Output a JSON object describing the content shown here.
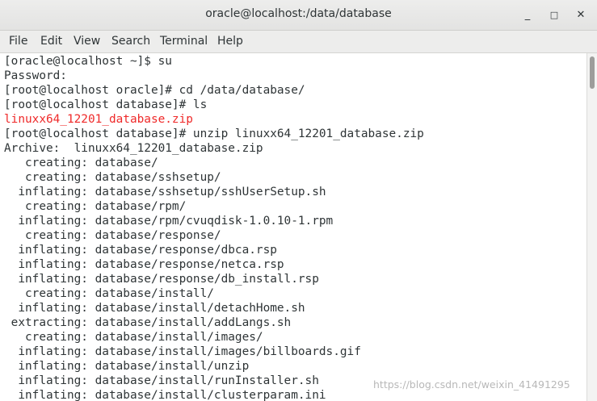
{
  "window": {
    "title": "oracle@localhost:/data/database",
    "minimize_label": "_",
    "maximize_label": "□",
    "close_label": "✕"
  },
  "menu": [
    "File",
    "Edit",
    "View",
    "Search",
    "Terminal",
    "Help"
  ],
  "terminal": {
    "lines": [
      {
        "text": "[oracle@localhost ~]$ su",
        "color": "default"
      },
      {
        "text": "Password:",
        "color": "default"
      },
      {
        "text": "[root@localhost oracle]# cd /data/database/",
        "color": "default"
      },
      {
        "text": "[root@localhost database]# ls",
        "color": "default"
      },
      {
        "text": "linuxx64_12201_database.zip",
        "color": "red"
      },
      {
        "text": "[root@localhost database]# unzip linuxx64_12201_database.zip",
        "color": "default"
      },
      {
        "text": "Archive:  linuxx64_12201_database.zip",
        "color": "default"
      },
      {
        "text": "   creating: database/",
        "color": "default"
      },
      {
        "text": "   creating: database/sshsetup/",
        "color": "default"
      },
      {
        "text": "  inflating: database/sshsetup/sshUserSetup.sh",
        "color": "default"
      },
      {
        "text": "   creating: database/rpm/",
        "color": "default"
      },
      {
        "text": "  inflating: database/rpm/cvuqdisk-1.0.10-1.rpm",
        "color": "default"
      },
      {
        "text": "   creating: database/response/",
        "color": "default"
      },
      {
        "text": "  inflating: database/response/dbca.rsp",
        "color": "default"
      },
      {
        "text": "  inflating: database/response/netca.rsp",
        "color": "default"
      },
      {
        "text": "  inflating: database/response/db_install.rsp",
        "color": "default"
      },
      {
        "text": "   creating: database/install/",
        "color": "default"
      },
      {
        "text": "  inflating: database/install/detachHome.sh",
        "color": "default"
      },
      {
        "text": " extracting: database/install/addLangs.sh",
        "color": "default"
      },
      {
        "text": "   creating: database/install/images/",
        "color": "default"
      },
      {
        "text": "  inflating: database/install/images/billboards.gif",
        "color": "default"
      },
      {
        "text": "  inflating: database/install/unzip",
        "color": "default"
      },
      {
        "text": "  inflating: database/install/runInstaller.sh",
        "color": "default"
      },
      {
        "text": "  inflating: database/install/clusterparam.ini",
        "color": "default"
      }
    ],
    "colors": {
      "default": "#2e3436",
      "red": "#ef2929",
      "background": "#ffffff"
    }
  },
  "watermark": "https://blog.csdn.net/weixin_41491295"
}
